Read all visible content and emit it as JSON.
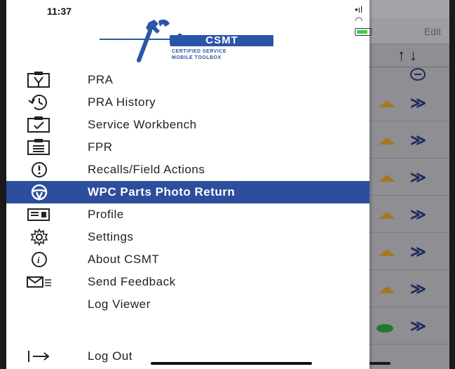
{
  "status": {
    "time": "11:37"
  },
  "logo": {
    "title": "CSMT",
    "subtitle_line1": "CERTIFIED SERVICE",
    "subtitle_line2": "MOBILE TOOLBOX"
  },
  "menu": [
    {
      "label": "PRA",
      "icon": "clipboard-wrench-icon"
    },
    {
      "label": "PRA History",
      "icon": "history-icon"
    },
    {
      "label": "Service Workbench",
      "icon": "clipboard-check-icon"
    },
    {
      "label": "FPR",
      "icon": "clipboard-list-icon"
    },
    {
      "label": "Recalls/Field Actions",
      "icon": "alert-circle-icon"
    },
    {
      "label": "WPC Parts Photo Return",
      "icon": "steering-wheel-icon",
      "active": true
    },
    {
      "label": "Profile",
      "icon": "id-card-icon"
    },
    {
      "label": "Settings",
      "icon": "gear-icon"
    },
    {
      "label": "About CSMT",
      "icon": "info-icon"
    },
    {
      "label": "Send Feedback",
      "icon": "envelope-icon"
    },
    {
      "label": "Log Viewer",
      "icon": ""
    },
    {
      "label": "Log Out",
      "icon": "logout-arrow-icon"
    }
  ],
  "background": {
    "edit_label": "Edit",
    "sort_label": "↑↓",
    "chevron": "≫",
    "rows": [
      "warning",
      "warning",
      "warning",
      "warning",
      "warning",
      "warning",
      "ok"
    ]
  },
  "colors": {
    "accent": "#2c4e9c",
    "brand": "#2b55a6",
    "warning": "#a37a1c",
    "ok": "#1f7a2a"
  }
}
